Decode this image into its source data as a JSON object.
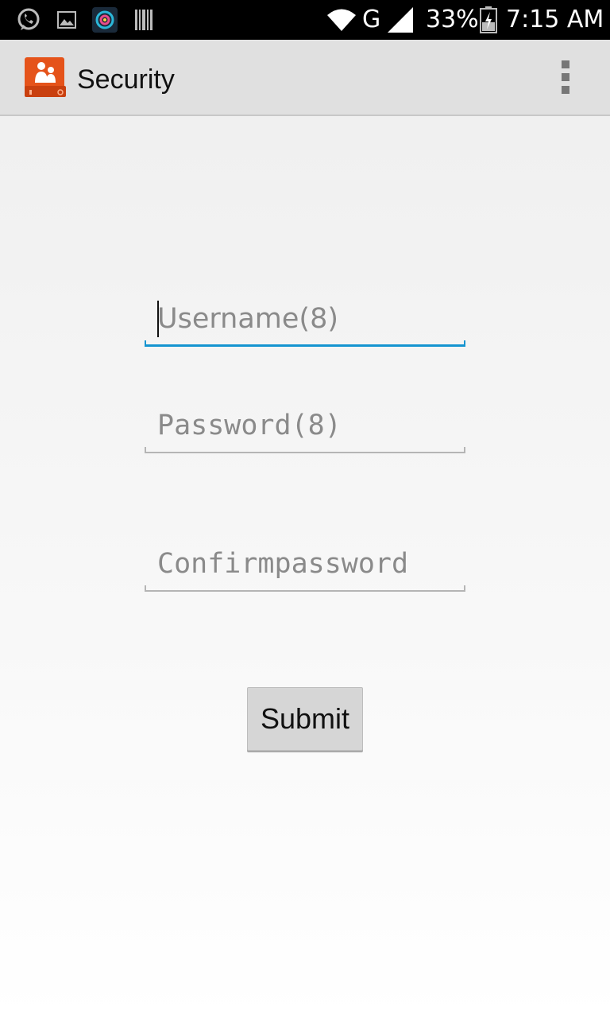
{
  "status_bar": {
    "icons": [
      "whatsapp-icon",
      "gallery-icon",
      "camera-app-icon",
      "barcode-icon",
      "wifi-icon",
      "signal-icon",
      "battery-charging-icon"
    ],
    "network_type": "G",
    "battery_percent": "33%",
    "time": "7:15 AM"
  },
  "action_bar": {
    "title": "Security",
    "app_icon": "security-app-icon",
    "menu_icon": "overflow-menu-icon"
  },
  "form": {
    "username_placeholder": "Username(8)",
    "password_placeholder": "Password(8)",
    "confirm_placeholder": "Confirmpassword",
    "submit_label": "Submit"
  },
  "colors": {
    "focus_accent": "#1594d0",
    "app_icon_orange": "#e5531a"
  }
}
